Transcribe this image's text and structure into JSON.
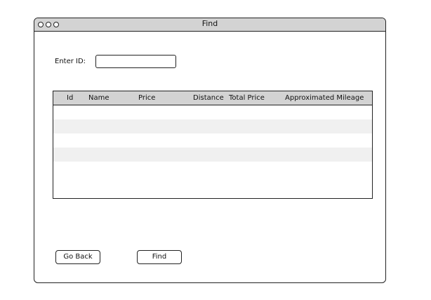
{
  "window": {
    "title": "Find"
  },
  "form": {
    "id_label": "Enter ID:",
    "id_value": "",
    "id_placeholder": ""
  },
  "table": {
    "columns": [
      "Id",
      "Name",
      "Price",
      "Distance",
      "Total Price",
      "Approximated Mileage"
    ],
    "rows": [
      [],
      [],
      [],
      [],
      [],
      [],
      []
    ]
  },
  "buttons": {
    "go_back": "Go Back",
    "find": "Find"
  },
  "colors": {
    "header_gray": "#d3d3d3",
    "stripe": "#f0f0f0",
    "border": "#222222"
  }
}
